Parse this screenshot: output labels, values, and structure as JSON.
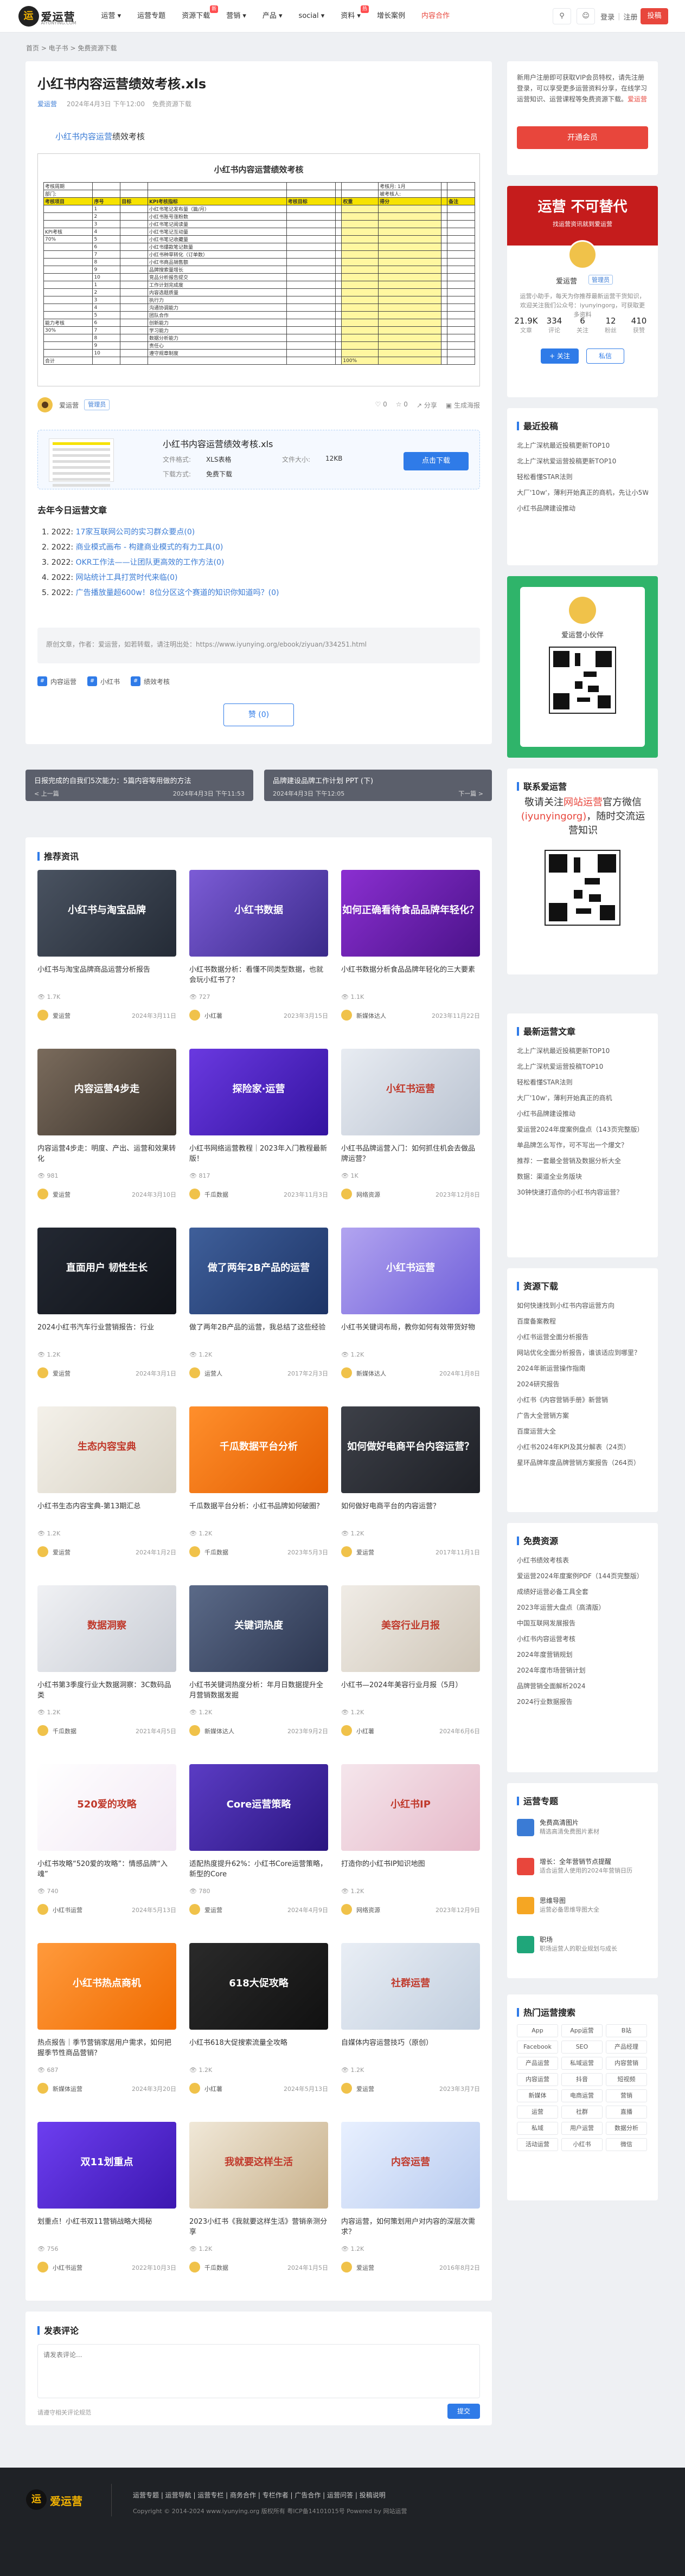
{
  "brand": {
    "name": "爱运营",
    "sub": "AIYUNYING.COM"
  },
  "nav": [
    {
      "label": "运营 ▾"
    },
    {
      "label": "运营专题"
    },
    {
      "label": "资源下载"
    },
    {
      "label": "营销 ▾"
    },
    {
      "label": "产品 ▾"
    },
    {
      "label": "social ▾"
    },
    {
      "label": "资料 ▾"
    },
    {
      "label": "增长案例"
    },
    {
      "label": "内容合作"
    }
  ],
  "nav_tags": {
    "t1": "新",
    "t2": "热"
  },
  "toolbar": {
    "login": "登录",
    "sep": "|",
    "register": "注册",
    "post": "投稿"
  },
  "breadcrumb": "首页 > 电子书 > 免费资源下载",
  "article": {
    "title": "小红书内容运营绩效考核.xls",
    "author": "爱运营",
    "date": "2024年4月3日 下午12:00",
    "tag": "免费资源下载",
    "lead_kw": "小红书内容运营",
    "lead_rest": "绩效考核",
    "sheet_title": "小红书内容运营绩效考核",
    "sheet_rows": [
      [
        "考核周期",
        "",
        "",
        "",
        "",
        "",
        "",
        "考核月: 1月",
        "",
        ""
      ],
      [
        "部门:",
        "",
        "",
        "",
        "",
        "",
        "",
        "被考核人:",
        "",
        ""
      ],
      [
        "考核项目",
        "序号",
        "目标",
        "KPI考核指标",
        "考核目标",
        "",
        "权重",
        "得分",
        "",
        "备注"
      ],
      [
        "",
        "1",
        "",
        "小红书笔记发布量（篇/月）",
        "",
        "",
        "",
        "",
        "",
        ""
      ],
      [
        "",
        "2",
        "",
        "小红书账号涨粉数",
        "",
        "",
        "",
        "",
        "",
        ""
      ],
      [
        "",
        "3",
        "",
        "小红书笔记阅读量",
        "",
        "",
        "",
        "",
        "",
        ""
      ],
      [
        "KPI考核",
        "4",
        "",
        "小红书笔记互动量",
        "",
        "",
        "",
        "",
        "",
        ""
      ],
      [
        "70%",
        "5",
        "",
        "小红书笔记收藏量",
        "",
        "",
        "",
        "",
        "",
        ""
      ],
      [
        "",
        "6",
        "",
        "小红书爆款笔记数量",
        "",
        "",
        "",
        "",
        "",
        ""
      ],
      [
        "",
        "7",
        "",
        "小红书种草转化（订单数）",
        "",
        "",
        "",
        "",
        "",
        ""
      ],
      [
        "",
        "8",
        "",
        "小红书商品销售额",
        "",
        "",
        "",
        "",
        "",
        ""
      ],
      [
        "",
        "9",
        "",
        "品牌搜索量增长",
        "",
        "",
        "",
        "",
        "",
        ""
      ],
      [
        "",
        "10",
        "",
        "竞品分析报告提交",
        "",
        "",
        "",
        "",
        "",
        ""
      ],
      [
        "",
        "1",
        "",
        "工作计划完成度",
        "",
        "",
        "",
        "",
        "",
        ""
      ],
      [
        "",
        "2",
        "",
        "内容选题质量",
        "",
        "",
        "",
        "",
        "",
        ""
      ],
      [
        "",
        "3",
        "",
        "执行力",
        "",
        "",
        "",
        "",
        "",
        ""
      ],
      [
        "",
        "4",
        "",
        "沟通协调能力",
        "",
        "",
        "",
        "",
        "",
        ""
      ],
      [
        "",
        "5",
        "",
        "团队合作",
        "",
        "",
        "",
        "",
        "",
        ""
      ],
      [
        "能力考核",
        "6",
        "",
        "创新能力",
        "",
        "",
        "",
        "",
        "",
        ""
      ],
      [
        "30%",
        "7",
        "",
        "学习能力",
        "",
        "",
        "",
        "",
        "",
        ""
      ],
      [
        "",
        "8",
        "",
        "数据分析能力",
        "",
        "",
        "",
        "",
        "",
        ""
      ],
      [
        "",
        "9",
        "",
        "责任心",
        "",
        "",
        "",
        "",
        "",
        ""
      ],
      [
        "",
        "10",
        "",
        "遵守规章制度",
        "",
        "",
        "",
        "",
        "",
        ""
      ],
      [
        "合计",
        "",
        "",
        "",
        "",
        "",
        "100%",
        "",
        "",
        ""
      ]
    ],
    "author_badge": "管理员",
    "actions": {
      "a1": "0",
      "a2": "0",
      "a3": "分享",
      "a4": "生成海报"
    },
    "download": {
      "name": "小红书内容运营绩效考核.xls",
      "k1": "文件格式:",
      "v1": "XLS表格",
      "k2": "文件大小:",
      "v2": "12KB",
      "k3": "下载方式:",
      "v3": "免费下载",
      "btn": "点击下载"
    },
    "related_title": "去年今日运营文章",
    "related": [
      {
        "d": "1. 2022:",
        "t": "17家互联网公司的实习群众要点(0)"
      },
      {
        "d": "2. 2022:",
        "t": "商业模式画布 - 构建商业模式的有力工具(0)"
      },
      {
        "d": "3. 2022:",
        "t": "OKR工作法——让团队更高效的工作方法(0)"
      },
      {
        "d": "4. 2022:",
        "t": "网站统计工具打赏时代来临(0)"
      },
      {
        "d": "5. 2022:",
        "t": "广告播放量超600w！8位分区这个赛道的知识你知道吗？(0)"
      }
    ],
    "source": "原创文章，作者：爱运营，如若转载，请注明出处：https://www.iyunying.org/ebook/ziyuan/334251.html",
    "tags": [
      "内容运营",
      "小红书",
      "绩效考核"
    ],
    "like": "赞 (0)"
  },
  "prevnext": {
    "prev_title": "日报完成的自我们5次能力：5篇内容等用做的方法",
    "prev_label": "< 上一篇",
    "prev_date": "2024年4月3日 下午11:53",
    "next_title": "品牌建设品牌工作计划 PPT (下)",
    "next_label": "下一篇 >",
    "next_date": "2024年4月3日 下午12:05"
  },
  "recommend_title": "推荐资讯",
  "recommend": [
    {
      "title": "小红书与淘宝品牌商品运营分析报告",
      "views": "1.7K",
      "author": "爱运营",
      "date": "2024年3月11日",
      "thumb": "小红书与淘宝品牌",
      "c1": "#4a5361",
      "c2": "#242b36"
    },
    {
      "title": "小红书数据分析：看懂不同类型数据，也就会玩小红书了？",
      "views": "727",
      "author": "小红薯",
      "date": "2023年3月15日",
      "thumb": "小红书数据",
      "c1": "#7c5cd6",
      "c2": "#3a2a8a"
    },
    {
      "title": "小红书数据分析食品品牌年轻化的三大要素",
      "views": "1.1K",
      "author": "新媒体达人",
      "date": "2023年11月22日",
      "thumb": "如何正确看待食品品牌年轻化？",
      "c1": "#8b2fd1",
      "c2": "#4b138a"
    },
    {
      "title": "内容运营4步走：明度、产出、运营和效果转化",
      "views": "981",
      "author": "爱运营",
      "date": "2024年3月10日",
      "thumb": "内容运营4步走",
      "c1": "#7a6b5c",
      "c2": "#3b332c"
    },
    {
      "title": "小红书网络运营教程｜2023年入门教程最新版！",
      "views": "817",
      "author": "千瓜数据",
      "date": "2023年11月3日",
      "thumb": "探险家·运营",
      "c1": "#6a39e0",
      "c2": "#3313a0"
    },
    {
      "title": "小红书品牌运营入门：如何抓住机会去做品牌运营？",
      "views": "1K",
      "author": "网络资源",
      "date": "2023年12月8日",
      "thumb": "小红书运营",
      "c1": "#e8ecf2",
      "c2": "#b9c2d0"
    },
    {
      "title": "2024小红书汽车行业营销报告：行业",
      "views": "1.2K",
      "author": "爱运营",
      "date": "2024年3月1日",
      "thumb": "直面用户 韧性生长",
      "c1": "#232832",
      "c2": "#11141a"
    },
    {
      "title": "做了两年2B产品的运营，我总结了这些经验",
      "views": "1.2K",
      "author": "运营人",
      "date": "2017年2月3日",
      "thumb": "做了两年2B产品的运营",
      "c1": "#3f5f9a",
      "c2": "#1d3466"
    },
    {
      "title": "小红书关键词布局，教你如何有效带货好物",
      "views": "1.2K",
      "author": "新媒体达人",
      "date": "2024年1月8日",
      "thumb": "小红书运营",
      "c1": "#b2a4f0",
      "c2": "#6f5fd9"
    },
    {
      "title": "小红书生态内容宝典-第13期汇总",
      "views": "1.2K",
      "author": "爱运营",
      "date": "2024年1月2日",
      "thumb": "生态内容宝典",
      "c1": "#f4f1ea",
      "c2": "#d8d2c4"
    },
    {
      "title": "千瓜数据平台分析：小红书品牌如何破圈？",
      "views": "1.2K",
      "author": "千瓜数据",
      "date": "2023年5月3日",
      "thumb": "千瓜数据平台分析",
      "c1": "#ff8f2c",
      "c2": "#e35d00"
    },
    {
      "title": "如何做好电商平台的内容运营？",
      "views": "1.2K",
      "author": "爱运营",
      "date": "2017年11月1日",
      "thumb": "如何做好电商平台内容运营？",
      "c1": "#3d4048",
      "c2": "#1e2026"
    },
    {
      "title": "小红书第3季度行业大数据洞察：3C数码品类",
      "views": "1.2K",
      "author": "千瓜数据",
      "date": "2021年4月5日",
      "thumb": "数据洞察",
      "c1": "#f0f1f4",
      "c2": "#c8ccd4"
    },
    {
      "title": "小红书关键词热度分析：年月日数据提升全月营销数据发掘",
      "views": "1.2K",
      "author": "新媒体达人",
      "date": "2023年9月2日",
      "thumb": "关键词热度",
      "c1": "#5b6a88",
      "c2": "#2c3650"
    },
    {
      "title": "小红书—2024年美容行业月报（5月）",
      "views": "1.2K",
      "author": "小红薯",
      "date": "2024年6月6日",
      "thumb": "美容行业月报",
      "c1": "#f0ece6",
      "c2": "#cfc6b8"
    },
    {
      "title": "小红书攻略“520爱的攻略”：情感品牌“入魂”",
      "views": "740",
      "author": "小红书运营",
      "date": "2024年5月13日",
      "thumb": "520爱的攻略",
      "c1": "#ffffff",
      "c2": "#f2e8f4"
    },
    {
      "title": "适配热度提升62%：小红书Core运营策略，新型的Core",
      "views": "780",
      "author": "爱运营",
      "date": "2024年4月9日",
      "thumb": "Core运营策略",
      "c1": "#5b3cc4",
      "c2": "#2a1580"
    },
    {
      "title": "打造你的小红书IP知识地图",
      "views": "1.2K",
      "author": "网络资源",
      "date": "2023年12月9日",
      "thumb": "小红书IP",
      "c1": "#f5e6ec",
      "c2": "#e6b9c9"
    },
    {
      "title": "热点报告｜季节营销家居用户需求，如何把握季节性商品营销？",
      "views": "687",
      "author": "新媒体运营",
      "date": "2024年3月20日",
      "thumb": "小红书热点商机",
      "c1": "#ff9a3c",
      "c2": "#f06b00"
    },
    {
      "title": "小红书618大促搜索流量全攻略",
      "views": "1.2K",
      "author": "小红薯",
      "date": "2024年5月13日",
      "thumb": "618大促攻略",
      "c1": "#2a2a2a",
      "c2": "#111111"
    },
    {
      "title": "自媒体内容运营技巧（原创）",
      "views": "1.2K",
      "author": "爱运营",
      "date": "2023年3月7日",
      "thumb": "社群运营",
      "c1": "#e9eef5",
      "c2": "#c1cede"
    },
    {
      "title": "划重点！小红书双11营销战略大揭秘",
      "views": "756",
      "author": "小红书运营",
      "date": "2022年10月3日",
      "thumb": "双11划重点",
      "c1": "#6d3ef0",
      "c2": "#3c17b0"
    },
    {
      "title": "2023小红书《我就要这样生活》营销亲测分享",
      "views": "1.2K",
      "author": "千瓜数据",
      "date": "2024年1月5日",
      "thumb": "我就要这样生活",
      "c1": "#f0e8d8",
      "c2": "#c8b08a"
    },
    {
      "title": "内容运营，如何策划用户对内容的深层次需求？",
      "views": "1.2K",
      "author": "爱运营",
      "date": "2016年8月2日",
      "thumb": "内容运营",
      "c1": "#e8f0ff",
      "c2": "#b8cbef"
    }
  ],
  "comment": {
    "title": "发表评论",
    "placeholder": "请发表评论...",
    "rule": "请遵守相关评论规范",
    "submit": "提交"
  },
  "sidebar": {
    "welcome": "新用户注册即可获取VIP会员特权，请先注册登录，可以享受更多运营资料分享，在线学习运营知识、运营课程等免费资源下载。",
    "welcome_red": "爱运营",
    "welcome_btn": "开通会员",
    "banner1": "运营 不可替代",
    "banner2": "找运营资讯就到爱运营",
    "profile_name": "爱运营",
    "profile_badge": "管理员",
    "profile_desc": "运营小助手，每天为你推荐最新运营干货知识，欢迎关注我们公众号：iyunyingorg，可获取更多资料",
    "stats": [
      {
        "n": "21.9K",
        "l": "文章"
      },
      {
        "n": "334",
        "l": "评论"
      },
      {
        "n": "6",
        "l": "关注"
      },
      {
        "n": "12",
        "l": "粉丝"
      },
      {
        "n": "410",
        "l": "获赞"
      }
    ],
    "follow": "+ 关注",
    "message": "私信",
    "latest_title": "最近投稿",
    "latest": [
      "北上广深杭最近投稿更新TOP10",
      "北上广深杭爱运营投稿更新TOP10",
      "轻松看懂STAR法则",
      "大厂'10w'，薄利开始真正的商机，先让小5W吧",
      "小红书品牌建设推动"
    ],
    "qr_name": "爱运营小伙伴",
    "follow_title": "联系爱运营",
    "follow_h1": "敬请关注",
    "follow_red1": "网站运营",
    "follow_h2": "官方微信",
    "follow_red2": "(iyunyingorg)",
    "follow_h3": "，随时交流运营知识",
    "hot_title": "最新运营文章",
    "hot": [
      "北上广深杭最近投稿更新TOP10",
      "北上广深杭爱运营投稿TOP10",
      "轻松看懂STAR法则",
      "大厂'10w'，薄利开始真正的商机",
      "小红书品牌建设推动",
      "爱运营2024年度案例盘点（143页完整版）",
      "单品牌怎么写作，可不写出一个爆文？",
      "推荐：一套最全营销及数据分析大全",
      "数据：渠道全业务版块",
      "30钟快速打造你的小红书内容运营？"
    ],
    "dl_title": "资源下载",
    "dl": [
      "如何快速找到小红书内容运营方向",
      "百度备案教程",
      "小红书运营全面分析报告",
      "网站优化全面分析报告，谁该适应到哪里？",
      "2024年新运营操作指南",
      "2024研究报告",
      "小红书《内容营销手册》新营销",
      "广告大全营销方案",
      "百度运营大全",
      "小红书2024年KPI及其分解表（24页）",
      "星环品牌年度品牌营销方案报告（264页）"
    ],
    "free_title": "免费资源",
    "free": [
      "小红书绩效考核表",
      "爱运营2024年度案例PDF（144页完整版）",
      "成绩好运营必备工具全套",
      "2023年运营大盘点（高清版）",
      "中国互联网发展报告",
      "小红书内容运营考核",
      "2024年度营销规划",
      "2024年度市场营销计划",
      "品牌营销全面解析2024",
      "2024行业数据报告"
    ],
    "ops_title": "运营专题",
    "ops": [
      {
        "n": "免费高清图片",
        "d": "精选高清免费图片素材",
        "c": "#3a7bd5"
      },
      {
        "n": "增长：全年营销节点提醒",
        "d": "适合运营人使用的2024年营销日历",
        "c": "#e8463c"
      },
      {
        "n": "思维导图",
        "d": "运营必备思维导图大全",
        "c": "#f5a623"
      },
      {
        "n": "职场",
        "d": "职场运营人的职业规划与成长",
        "c": "#1fa67a"
      }
    ],
    "tags_title": "热门运营搜索",
    "tags": [
      "App",
      "App运营",
      "B站",
      "Facebook",
      "SEO",
      "产品经理",
      "产品运营",
      "私域运营",
      "内容营销",
      "内容运营",
      "抖音",
      "短视频",
      "新媒体",
      "电商运营",
      "营销",
      "运营",
      "社群",
      "直播",
      "私域",
      "用户运营",
      "数据分析",
      "活动运营",
      "小红书",
      "微信"
    ]
  },
  "footer": {
    "links": "运营专题  |  运营导航  |  运营专栏  |  商务合作  |  专栏作者  |  广告合作  |  运营问答  |  投稿说明",
    "copy": "Copyright © 2014-2024 www.iyunying.org 版权所有 粤ICP备14101015号 Powered by 网站运营"
  },
  "colors": {
    "primary": "#2f7be8",
    "accent": "#e8463c"
  }
}
